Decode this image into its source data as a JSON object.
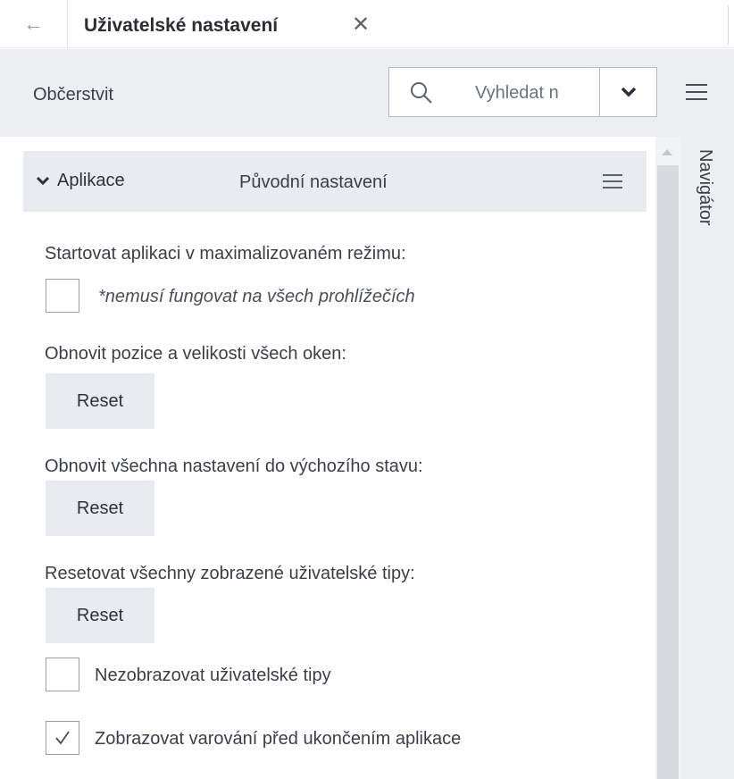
{
  "tab": {
    "back_icon": "arrow-left-icon",
    "title": "Uživatelské nastavení",
    "close_icon": "close-icon"
  },
  "toolbar": {
    "refresh_label": "Občerstvit",
    "search_placeholder": "Vyhledat n",
    "search_icon": "search-icon",
    "dropdown_icon": "chevron-down-icon",
    "menu_icon": "hamburger-menu-icon"
  },
  "section": {
    "title": "Aplikace",
    "subtitle": "Původní nastavení",
    "expanded": true
  },
  "settings": {
    "maximized_label": "Startovat aplikaci v maximalizovaném režimu:",
    "maximized_note": "*nemusí fungovat na všech prohlížečích",
    "maximized_checked": false,
    "window_pos_label": "Obnovit pozice a velikosti všech oken:",
    "window_pos_button": "Reset",
    "defaults_label": "Obnovit všechna nastavení do výchozího stavu:",
    "defaults_button": "Reset",
    "tips_label": "Resetovat všechny zobrazené uživatelské tipy:",
    "tips_button": "Reset",
    "hide_tips_label": "Nezobrazovat uživatelské tipy",
    "hide_tips_checked": false,
    "exit_warning_label": "Zobrazovat varování před ukončením aplikace",
    "exit_warning_checked": true
  },
  "navigator": {
    "label": "Navigátor"
  },
  "colors": {
    "toolbar_bg": "#eceef2",
    "section_bg": "#e8ebf0",
    "button_bg": "#e8ebf0",
    "text": "#3b3f45"
  }
}
